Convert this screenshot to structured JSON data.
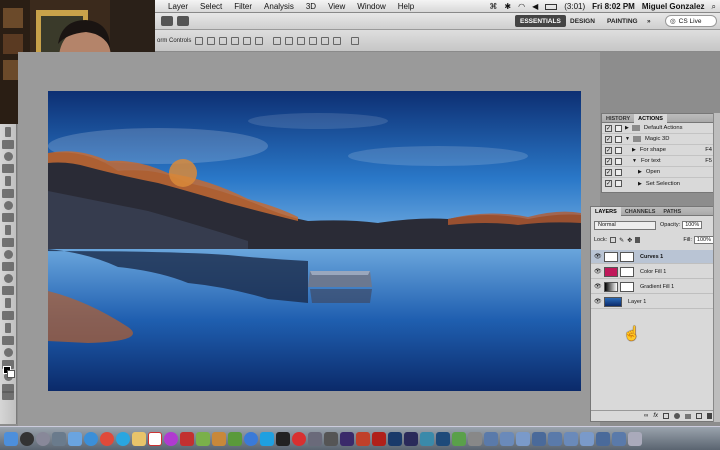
{
  "menubar": {
    "items": [
      "Layer",
      "Select",
      "Filter",
      "Analysis",
      "3D",
      "View",
      "Window",
      "Help"
    ],
    "battery": "(3:01)",
    "clock": "Fri 8:02 PM",
    "user": "Miguel Gonzalez"
  },
  "appbar": {
    "workspaces": [
      "ESSENTIALS",
      "DESIGN",
      "PAINTING"
    ],
    "more": "»",
    "cs_live": "CS Live"
  },
  "options": {
    "label": "orm Controls"
  },
  "actions_panel": {
    "tabs": [
      "HISTORY",
      "ACTIONS"
    ],
    "rows": [
      {
        "label": "Default Actions",
        "key": ""
      },
      {
        "label": "Magic 3D",
        "key": ""
      },
      {
        "label": "For shape",
        "key": "F4"
      },
      {
        "label": "For text",
        "key": "F5"
      },
      {
        "label": "Open",
        "key": ""
      },
      {
        "label": "Set Selection",
        "key": ""
      }
    ]
  },
  "layers_panel": {
    "tabs": [
      "LAYERS",
      "CHANNELS",
      "PATHS"
    ],
    "blend_mode": "Normal",
    "opacity_label": "Opacity:",
    "opacity_value": "100%",
    "lock_label": "Lock:",
    "fill_label": "Fill:",
    "fill_value": "100%",
    "layers": [
      {
        "name": "Curves 1"
      },
      {
        "name": "Color Fill 1"
      },
      {
        "name": "Gradient Fill 1"
      },
      {
        "name": "Layer 1"
      }
    ]
  },
  "colors": {
    "color_fill_swatch": "#c0185a",
    "selection": "#3a6fd6"
  }
}
